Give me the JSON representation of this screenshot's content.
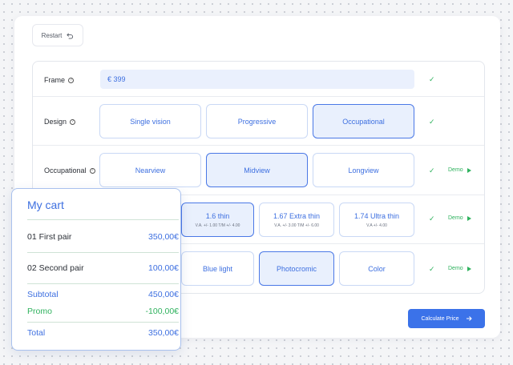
{
  "toolbar": {
    "restart_label": "Restart"
  },
  "frame": {
    "label": "Frame",
    "value": "€ 399",
    "check": "✓"
  },
  "design": {
    "label": "Design",
    "options": [
      "Single vision",
      "Progressive",
      "Occupational"
    ],
    "selected": "Occupational",
    "check": "✓"
  },
  "occupational": {
    "label": "Occupational",
    "options": [
      "Nearview",
      "Midview",
      "Longview"
    ],
    "selected": "Midview",
    "check": "✓",
    "demo": "Demo"
  },
  "thickness": {
    "options": [
      {
        "title": "1.6 thin",
        "sub": "V.A. +/- 1.00 T/M +/- 4.00"
      },
      {
        "title": "1.67 Extra thin",
        "sub": "V.A. +/- 3.00 T/M +/- 6.00"
      },
      {
        "title": "1.74 Ultra thin",
        "sub": "V.A +/- 4.00"
      }
    ],
    "selected": "1.6 thin",
    "check": "✓",
    "demo": "Demo"
  },
  "coating": {
    "options": [
      "Blue light",
      "Photocromic",
      "Color"
    ],
    "selected": "Photocromic",
    "check": "✓",
    "demo": "Demo"
  },
  "calculate": {
    "label": "Calculate Price"
  },
  "cart": {
    "title": "My cart",
    "items": [
      {
        "label": "01 First pair",
        "value": "350,00€"
      },
      {
        "label": "02 Second pair",
        "value": "100,00€"
      }
    ],
    "subtotal": {
      "label": "Subtotal",
      "value": "450,00€"
    },
    "promo": {
      "label": "Promo",
      "value": "-100,00€"
    },
    "total": {
      "label": "Total",
      "value": "350,00€"
    }
  },
  "colors": {
    "accent": "#3b72e9",
    "success": "#2fb25e",
    "selected_bg": "#e9f0fd"
  }
}
